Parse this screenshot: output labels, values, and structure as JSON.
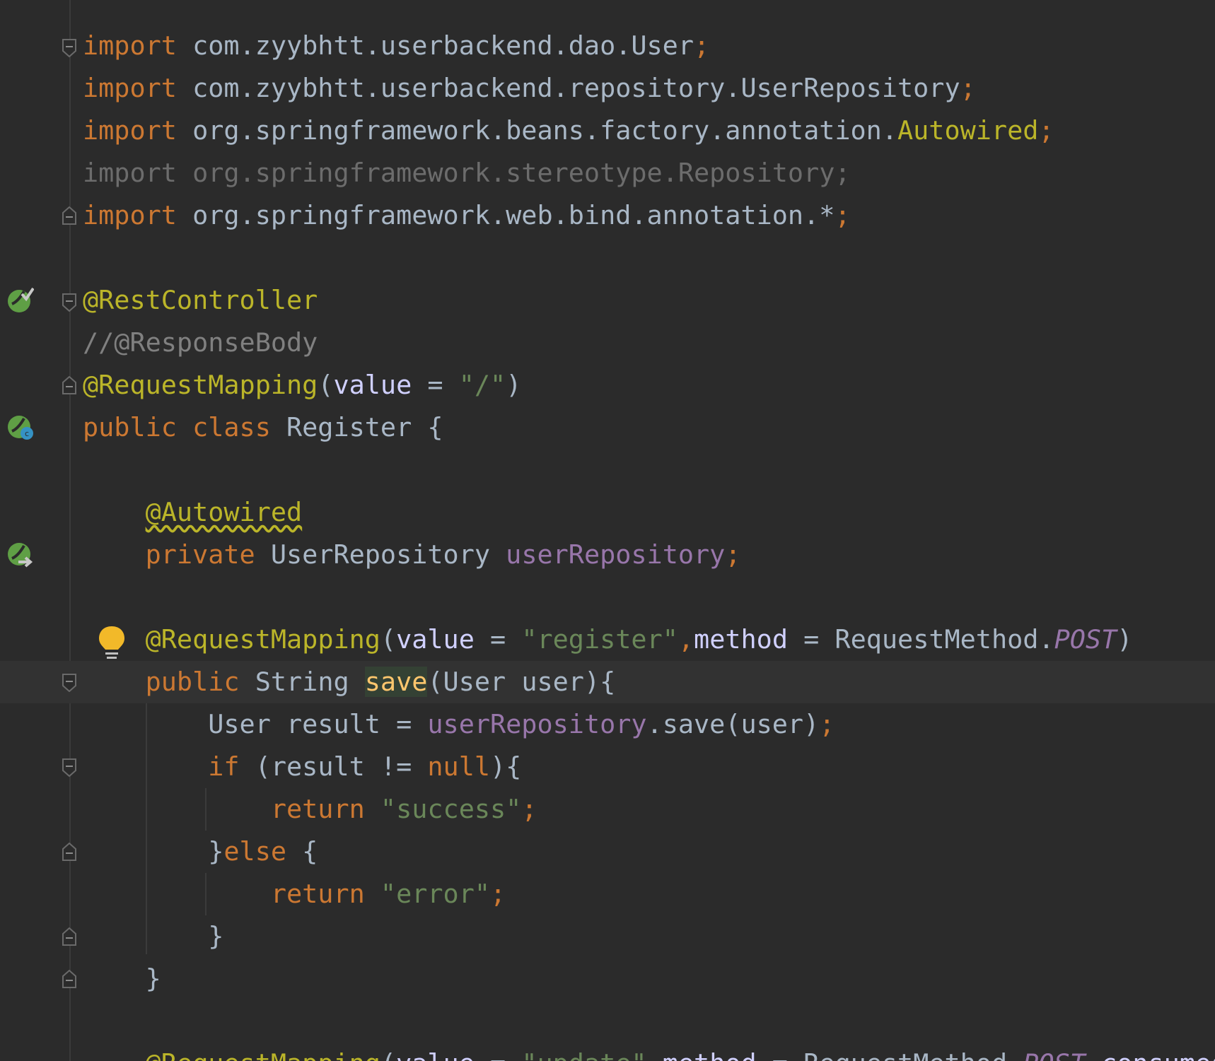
{
  "editor": {
    "lines": [
      [
        [
          "k",
          "import "
        ],
        [
          "t",
          "com.zyybhtt.userbackend.dao.User"
        ],
        [
          "k",
          ";"
        ]
      ],
      [
        [
          "k",
          "import "
        ],
        [
          "t",
          "com.zyybhtt.userbackend.repository.UserRepository"
        ],
        [
          "k",
          ";"
        ]
      ],
      [
        [
          "k",
          "import "
        ],
        [
          "t",
          "org.springframework.beans.factory.annotation."
        ],
        [
          "an",
          "Autowired"
        ],
        [
          "k",
          ";"
        ]
      ],
      [
        [
          "un",
          "import org.springframework.stereotype.Repository;"
        ]
      ],
      [
        [
          "k",
          "import "
        ],
        [
          "t",
          "org.springframework.web.bind.annotation.*"
        ],
        [
          "k",
          ";"
        ]
      ],
      [],
      [
        [
          "an",
          "@RestController"
        ]
      ],
      [
        [
          "cm",
          "//@ResponseBody"
        ]
      ],
      [
        [
          "an",
          "@RequestMapping"
        ],
        [
          "t",
          "("
        ],
        [
          "pv",
          "value"
        ],
        [
          "t",
          " = "
        ],
        [
          "s",
          "\"/\""
        ],
        [
          "t",
          ")"
        ]
      ],
      [
        [
          "k",
          "public class "
        ],
        [
          "t",
          "Register {"
        ]
      ],
      [],
      [
        [
          "t",
          "    "
        ],
        [
          "an warn",
          "@Autowired"
        ]
      ],
      [
        [
          "t",
          "    "
        ],
        [
          "k",
          "private "
        ],
        [
          "t",
          "UserRepository "
        ],
        [
          "f",
          "userRepository"
        ],
        [
          "k",
          ";"
        ]
      ],
      [],
      [
        [
          "t",
          "    "
        ],
        [
          "an",
          "@RequestMapping"
        ],
        [
          "t",
          "("
        ],
        [
          "pv",
          "value"
        ],
        [
          "t",
          " = "
        ],
        [
          "s",
          "\"register\""
        ],
        [
          "k",
          ","
        ],
        [
          "pv",
          "method"
        ],
        [
          "t",
          " = RequestMethod."
        ],
        [
          "fi",
          "POST"
        ],
        [
          "t",
          ")"
        ]
      ],
      [
        [
          "t",
          "    "
        ],
        [
          "k",
          "public "
        ],
        [
          "t",
          "String "
        ],
        [
          "mn hl",
          "save"
        ],
        [
          "t",
          "(User user){"
        ]
      ],
      [
        [
          "t",
          "        User result = "
        ],
        [
          "f",
          "userRepository"
        ],
        [
          "t",
          ".save(user)"
        ],
        [
          "k",
          ";"
        ]
      ],
      [
        [
          "t",
          "        "
        ],
        [
          "k",
          "if "
        ],
        [
          "t",
          "(result != "
        ],
        [
          "k",
          "null"
        ],
        [
          "t",
          "){"
        ]
      ],
      [
        [
          "t",
          "            "
        ],
        [
          "k",
          "return "
        ],
        [
          "s",
          "\"success\""
        ],
        [
          "k",
          ";"
        ]
      ],
      [
        [
          "t",
          "        }"
        ],
        [
          "k",
          "else "
        ],
        [
          "t",
          "{"
        ]
      ],
      [
        [
          "t",
          "            "
        ],
        [
          "k",
          "return "
        ],
        [
          "s",
          "\"error\""
        ],
        [
          "k",
          ";"
        ]
      ],
      [
        [
          "t",
          "        }"
        ]
      ],
      [
        [
          "t",
          "    }"
        ]
      ],
      [],
      [
        [
          "t",
          "    "
        ],
        [
          "an",
          "@RequestMapping"
        ],
        [
          "t",
          "("
        ],
        [
          "pv",
          "value"
        ],
        [
          "t",
          " = "
        ],
        [
          "s",
          "\"update\""
        ],
        [
          "k",
          ","
        ],
        [
          "pv",
          "method"
        ],
        [
          "t",
          " = RequestMethod."
        ],
        [
          "fi",
          "POST"
        ],
        [
          "k",
          ","
        ],
        [
          "pv",
          "consumes"
        ]
      ]
    ]
  },
  "gutter": {
    "icons": [
      "spring-bean-check-icon",
      "spring-class-icon",
      "spring-autowired-icon",
      "intention-bulb-icon"
    ]
  },
  "colors": {
    "background": "#2b2b2b",
    "keyword": "#cc7832",
    "annotation": "#bbb529",
    "string": "#6a8759",
    "field": "#9876aa",
    "comment": "#808080",
    "text": "#a9b7c6"
  }
}
